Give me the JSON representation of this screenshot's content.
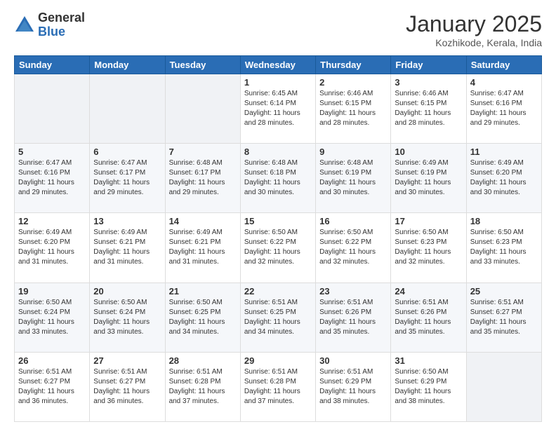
{
  "header": {
    "logo_general": "General",
    "logo_blue": "Blue",
    "month_title": "January 2025",
    "location": "Kozhikode, Kerala, India"
  },
  "days_of_week": [
    "Sunday",
    "Monday",
    "Tuesday",
    "Wednesday",
    "Thursday",
    "Friday",
    "Saturday"
  ],
  "weeks": [
    [
      {
        "day": "",
        "info": ""
      },
      {
        "day": "",
        "info": ""
      },
      {
        "day": "",
        "info": ""
      },
      {
        "day": "1",
        "info": "Sunrise: 6:45 AM\nSunset: 6:14 PM\nDaylight: 11 hours\nand 28 minutes."
      },
      {
        "day": "2",
        "info": "Sunrise: 6:46 AM\nSunset: 6:15 PM\nDaylight: 11 hours\nand 28 minutes."
      },
      {
        "day": "3",
        "info": "Sunrise: 6:46 AM\nSunset: 6:15 PM\nDaylight: 11 hours\nand 28 minutes."
      },
      {
        "day": "4",
        "info": "Sunrise: 6:47 AM\nSunset: 6:16 PM\nDaylight: 11 hours\nand 29 minutes."
      }
    ],
    [
      {
        "day": "5",
        "info": "Sunrise: 6:47 AM\nSunset: 6:16 PM\nDaylight: 11 hours\nand 29 minutes."
      },
      {
        "day": "6",
        "info": "Sunrise: 6:47 AM\nSunset: 6:17 PM\nDaylight: 11 hours\nand 29 minutes."
      },
      {
        "day": "7",
        "info": "Sunrise: 6:48 AM\nSunset: 6:17 PM\nDaylight: 11 hours\nand 29 minutes."
      },
      {
        "day": "8",
        "info": "Sunrise: 6:48 AM\nSunset: 6:18 PM\nDaylight: 11 hours\nand 30 minutes."
      },
      {
        "day": "9",
        "info": "Sunrise: 6:48 AM\nSunset: 6:19 PM\nDaylight: 11 hours\nand 30 minutes."
      },
      {
        "day": "10",
        "info": "Sunrise: 6:49 AM\nSunset: 6:19 PM\nDaylight: 11 hours\nand 30 minutes."
      },
      {
        "day": "11",
        "info": "Sunrise: 6:49 AM\nSunset: 6:20 PM\nDaylight: 11 hours\nand 30 minutes."
      }
    ],
    [
      {
        "day": "12",
        "info": "Sunrise: 6:49 AM\nSunset: 6:20 PM\nDaylight: 11 hours\nand 31 minutes."
      },
      {
        "day": "13",
        "info": "Sunrise: 6:49 AM\nSunset: 6:21 PM\nDaylight: 11 hours\nand 31 minutes."
      },
      {
        "day": "14",
        "info": "Sunrise: 6:49 AM\nSunset: 6:21 PM\nDaylight: 11 hours\nand 31 minutes."
      },
      {
        "day": "15",
        "info": "Sunrise: 6:50 AM\nSunset: 6:22 PM\nDaylight: 11 hours\nand 32 minutes."
      },
      {
        "day": "16",
        "info": "Sunrise: 6:50 AM\nSunset: 6:22 PM\nDaylight: 11 hours\nand 32 minutes."
      },
      {
        "day": "17",
        "info": "Sunrise: 6:50 AM\nSunset: 6:23 PM\nDaylight: 11 hours\nand 32 minutes."
      },
      {
        "day": "18",
        "info": "Sunrise: 6:50 AM\nSunset: 6:23 PM\nDaylight: 11 hours\nand 33 minutes."
      }
    ],
    [
      {
        "day": "19",
        "info": "Sunrise: 6:50 AM\nSunset: 6:24 PM\nDaylight: 11 hours\nand 33 minutes."
      },
      {
        "day": "20",
        "info": "Sunrise: 6:50 AM\nSunset: 6:24 PM\nDaylight: 11 hours\nand 33 minutes."
      },
      {
        "day": "21",
        "info": "Sunrise: 6:50 AM\nSunset: 6:25 PM\nDaylight: 11 hours\nand 34 minutes."
      },
      {
        "day": "22",
        "info": "Sunrise: 6:51 AM\nSunset: 6:25 PM\nDaylight: 11 hours\nand 34 minutes."
      },
      {
        "day": "23",
        "info": "Sunrise: 6:51 AM\nSunset: 6:26 PM\nDaylight: 11 hours\nand 35 minutes."
      },
      {
        "day": "24",
        "info": "Sunrise: 6:51 AM\nSunset: 6:26 PM\nDaylight: 11 hours\nand 35 minutes."
      },
      {
        "day": "25",
        "info": "Sunrise: 6:51 AM\nSunset: 6:27 PM\nDaylight: 11 hours\nand 35 minutes."
      }
    ],
    [
      {
        "day": "26",
        "info": "Sunrise: 6:51 AM\nSunset: 6:27 PM\nDaylight: 11 hours\nand 36 minutes."
      },
      {
        "day": "27",
        "info": "Sunrise: 6:51 AM\nSunset: 6:27 PM\nDaylight: 11 hours\nand 36 minutes."
      },
      {
        "day": "28",
        "info": "Sunrise: 6:51 AM\nSunset: 6:28 PM\nDaylight: 11 hours\nand 37 minutes."
      },
      {
        "day": "29",
        "info": "Sunrise: 6:51 AM\nSunset: 6:28 PM\nDaylight: 11 hours\nand 37 minutes."
      },
      {
        "day": "30",
        "info": "Sunrise: 6:51 AM\nSunset: 6:29 PM\nDaylight: 11 hours\nand 38 minutes."
      },
      {
        "day": "31",
        "info": "Sunrise: 6:50 AM\nSunset: 6:29 PM\nDaylight: 11 hours\nand 38 minutes."
      },
      {
        "day": "",
        "info": ""
      }
    ]
  ]
}
